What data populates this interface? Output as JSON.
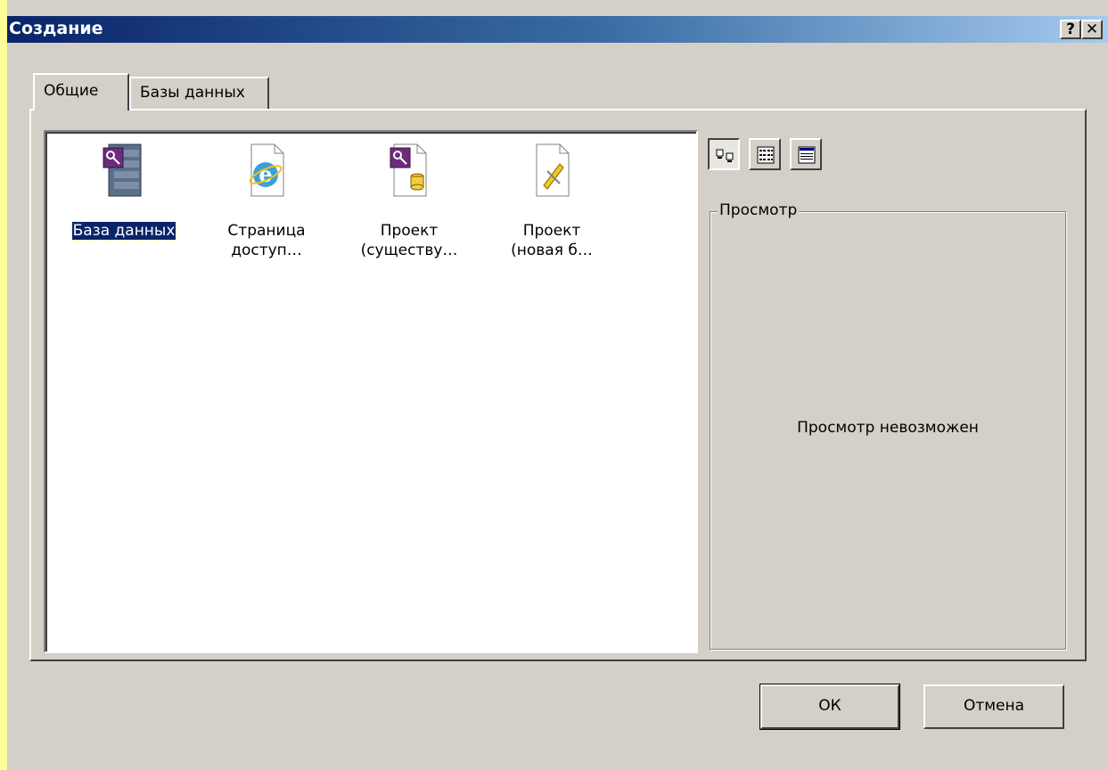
{
  "window": {
    "title": "Создание",
    "help_label": "?",
    "close_label": "✕"
  },
  "tabs": [
    {
      "label": "Общие",
      "active": true
    },
    {
      "label": "Базы данных",
      "active": false
    }
  ],
  "items": [
    {
      "label": "База данных",
      "icon": "access-database-icon",
      "selected": true
    },
    {
      "label": "Страница доступ…",
      "icon": "data-access-page-icon",
      "selected": false
    },
    {
      "label": "Проект (существу…",
      "icon": "project-existing-database-icon",
      "selected": false
    },
    {
      "label": "Проект (новая б…",
      "icon": "project-new-database-icon",
      "selected": false
    }
  ],
  "view_buttons": [
    {
      "icon": "large-icons-icon",
      "pressed": true
    },
    {
      "icon": "list-view-icon",
      "pressed": false
    },
    {
      "icon": "details-view-icon",
      "pressed": false
    }
  ],
  "preview": {
    "label": "Просмотр",
    "message": "Просмотр невозможен"
  },
  "buttons": {
    "ok_label": "ОК",
    "cancel_label": "Отмена"
  },
  "colors": {
    "title_bar_start": "#0a246a",
    "dialog_face": "#d4d0c8",
    "selection": "#0a246a",
    "page_background": "#ffff99"
  }
}
